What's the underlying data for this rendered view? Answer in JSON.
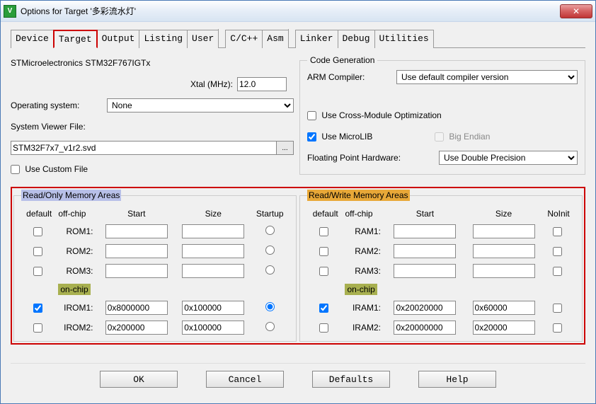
{
  "title": "Options for Target '多彩流水灯'",
  "tabs": [
    "Device",
    "Target",
    "Output",
    "Listing",
    "User",
    "C/C++",
    "Asm",
    "Linker",
    "Debug",
    "Utilities"
  ],
  "active_tab": 1,
  "device_name": "STMicroelectronics STM32F767IGTx",
  "xtal": {
    "label": "Xtal (MHz):",
    "value": "12.0"
  },
  "os": {
    "label": "Operating system:",
    "value": "None"
  },
  "svf": {
    "label": "System Viewer File:",
    "value": "STM32F7x7_v1r2.svd"
  },
  "use_custom_file": {
    "label": "Use Custom File",
    "checked": false
  },
  "codegen": {
    "legend": "Code Generation",
    "compiler": {
      "label": "ARM Compiler:",
      "value": "Use default compiler version"
    },
    "cross_module": {
      "label": "Use Cross-Module Optimization",
      "checked": false
    },
    "microlib": {
      "label": "Use MicroLIB",
      "checked": true
    },
    "big_endian": {
      "label": "Big Endian",
      "checked": false
    },
    "float": {
      "label": "Floating Point Hardware:",
      "value": "Use Double Precision"
    }
  },
  "ro": {
    "legend": "Read/Only Memory Areas",
    "headers": {
      "default": "default",
      "chip": "off-chip",
      "start": "Start",
      "size": "Size",
      "startup": "Startup",
      "onchip": "on-chip"
    },
    "rows": [
      {
        "name": "ROM1:",
        "default": false,
        "start": "",
        "size": "",
        "startup": false
      },
      {
        "name": "ROM2:",
        "default": false,
        "start": "",
        "size": "",
        "startup": false
      },
      {
        "name": "ROM3:",
        "default": false,
        "start": "",
        "size": "",
        "startup": false
      },
      {
        "name": "IROM1:",
        "default": true,
        "start": "0x8000000",
        "size": "0x100000",
        "startup": true
      },
      {
        "name": "IROM2:",
        "default": false,
        "start": "0x200000",
        "size": "0x100000",
        "startup": false
      }
    ]
  },
  "rw": {
    "legend": "Read/Write Memory Areas",
    "headers": {
      "default": "default",
      "chip": "off-chip",
      "start": "Start",
      "size": "Size",
      "noinit": "NoInit",
      "onchip": "on-chip"
    },
    "rows": [
      {
        "name": "RAM1:",
        "default": false,
        "start": "",
        "size": "",
        "noinit": false
      },
      {
        "name": "RAM2:",
        "default": false,
        "start": "",
        "size": "",
        "noinit": false
      },
      {
        "name": "RAM3:",
        "default": false,
        "start": "",
        "size": "",
        "noinit": false
      },
      {
        "name": "IRAM1:",
        "default": true,
        "start": "0x20020000",
        "size": "0x60000",
        "noinit": false
      },
      {
        "name": "IRAM2:",
        "default": false,
        "start": "0x20000000",
        "size": "0x20000",
        "noinit": false
      }
    ]
  },
  "buttons": {
    "ok": "OK",
    "cancel": "Cancel",
    "defaults": "Defaults",
    "help": "Help"
  }
}
